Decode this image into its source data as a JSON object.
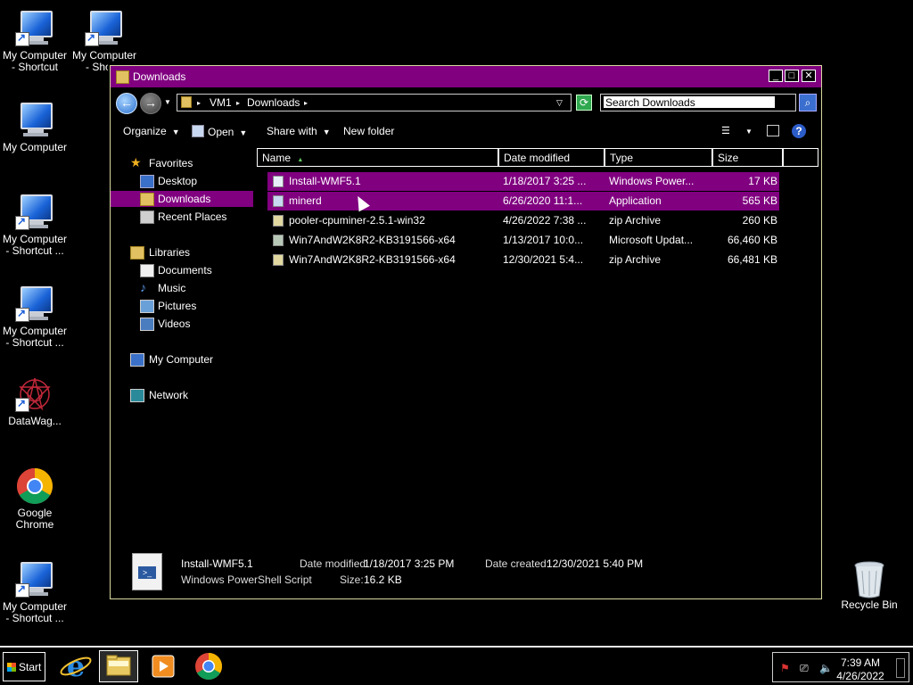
{
  "desktop": {
    "icons": [
      {
        "label": "My Computer - Shortcut",
        "icon": "my-computer-icon",
        "shortcut": true
      },
      {
        "label": "My Computer - Shortc",
        "icon": "my-computer-icon",
        "shortcut": true
      },
      {
        "label": "My Computer",
        "icon": "my-computer-icon",
        "shortcut": false
      },
      {
        "label": "My Computer - Shortcut ...",
        "icon": "my-computer-icon",
        "shortcut": true
      },
      {
        "label": "My Computer - Shortcut ...",
        "icon": "my-computer-icon",
        "shortcut": true
      },
      {
        "label": "DataWag...",
        "icon": "datawag-icon",
        "shortcut": true
      },
      {
        "label": "Google Chrome",
        "icon": "chrome-icon",
        "shortcut": false
      },
      {
        "label": "My Computer - Shortcut ...",
        "icon": "my-computer-icon",
        "shortcut": true
      },
      {
        "label": "Recycle Bin",
        "icon": "recycle-bin-icon",
        "shortcut": false
      }
    ]
  },
  "window": {
    "title": "Downloads",
    "controls": {
      "minimize": "_",
      "maximize": "□",
      "close": "✕"
    },
    "address": {
      "root": "VM1",
      "folder": "Downloads"
    },
    "search": {
      "placeholder": "Search Downloads"
    },
    "toolbar": {
      "organize": "Organize",
      "open": "Open",
      "share": "Share with",
      "new_folder": "New folder"
    },
    "nav": {
      "favorites": "Favorites",
      "desktop": "Desktop",
      "downloads": "Downloads",
      "recent": "Recent Places",
      "libraries": "Libraries",
      "documents": "Documents",
      "music": "Music",
      "pictures": "Pictures",
      "videos": "Videos",
      "computer": "My Computer",
      "network": "Network"
    },
    "columns": {
      "name": "Name",
      "date": "Date modified",
      "type": "Type",
      "size": "Size"
    },
    "files": [
      {
        "name": "Install-WMF5.1",
        "date": "1/18/2017 3:25 ...",
        "type": "Windows Power...",
        "size": "17 KB",
        "selected": true
      },
      {
        "name": "minerd",
        "date": "6/26/2020 11:1...",
        "type": "Application",
        "size": "565 KB",
        "selected": true
      },
      {
        "name": "pooler-cpuminer-2.5.1-win32",
        "date": "4/26/2022 7:38 ...",
        "type": "zip Archive",
        "size": "260 KB",
        "selected": false
      },
      {
        "name": "Win7AndW2K8R2-KB3191566-x64",
        "date": "1/13/2017 10:0...",
        "type": "Microsoft Updat...",
        "size": "66,460 KB",
        "selected": false
      },
      {
        "name": "Win7AndW2K8R2-KB3191566-x64",
        "date": "12/30/2021 5:4...",
        "type": "zip Archive",
        "size": "66,481 KB",
        "selected": false
      }
    ],
    "details": {
      "name": "Install-WMF5.1",
      "kind": "Windows PowerShell Script",
      "modified_label": "Date modified:",
      "modified": "1/18/2017 3:25 PM",
      "size_label": "Size:",
      "size": "16.2 KB",
      "created_label": "Date created:",
      "created": "12/30/2021 5:40 PM"
    }
  },
  "taskbar": {
    "start": "Start",
    "apps": [
      "internet-explorer-icon",
      "windows-explorer-icon",
      "media-player-icon",
      "chrome-icon"
    ],
    "time": "7:39 AM",
    "date": "4/26/2022"
  },
  "colors": {
    "selection": "#800080",
    "background": "#000000"
  }
}
